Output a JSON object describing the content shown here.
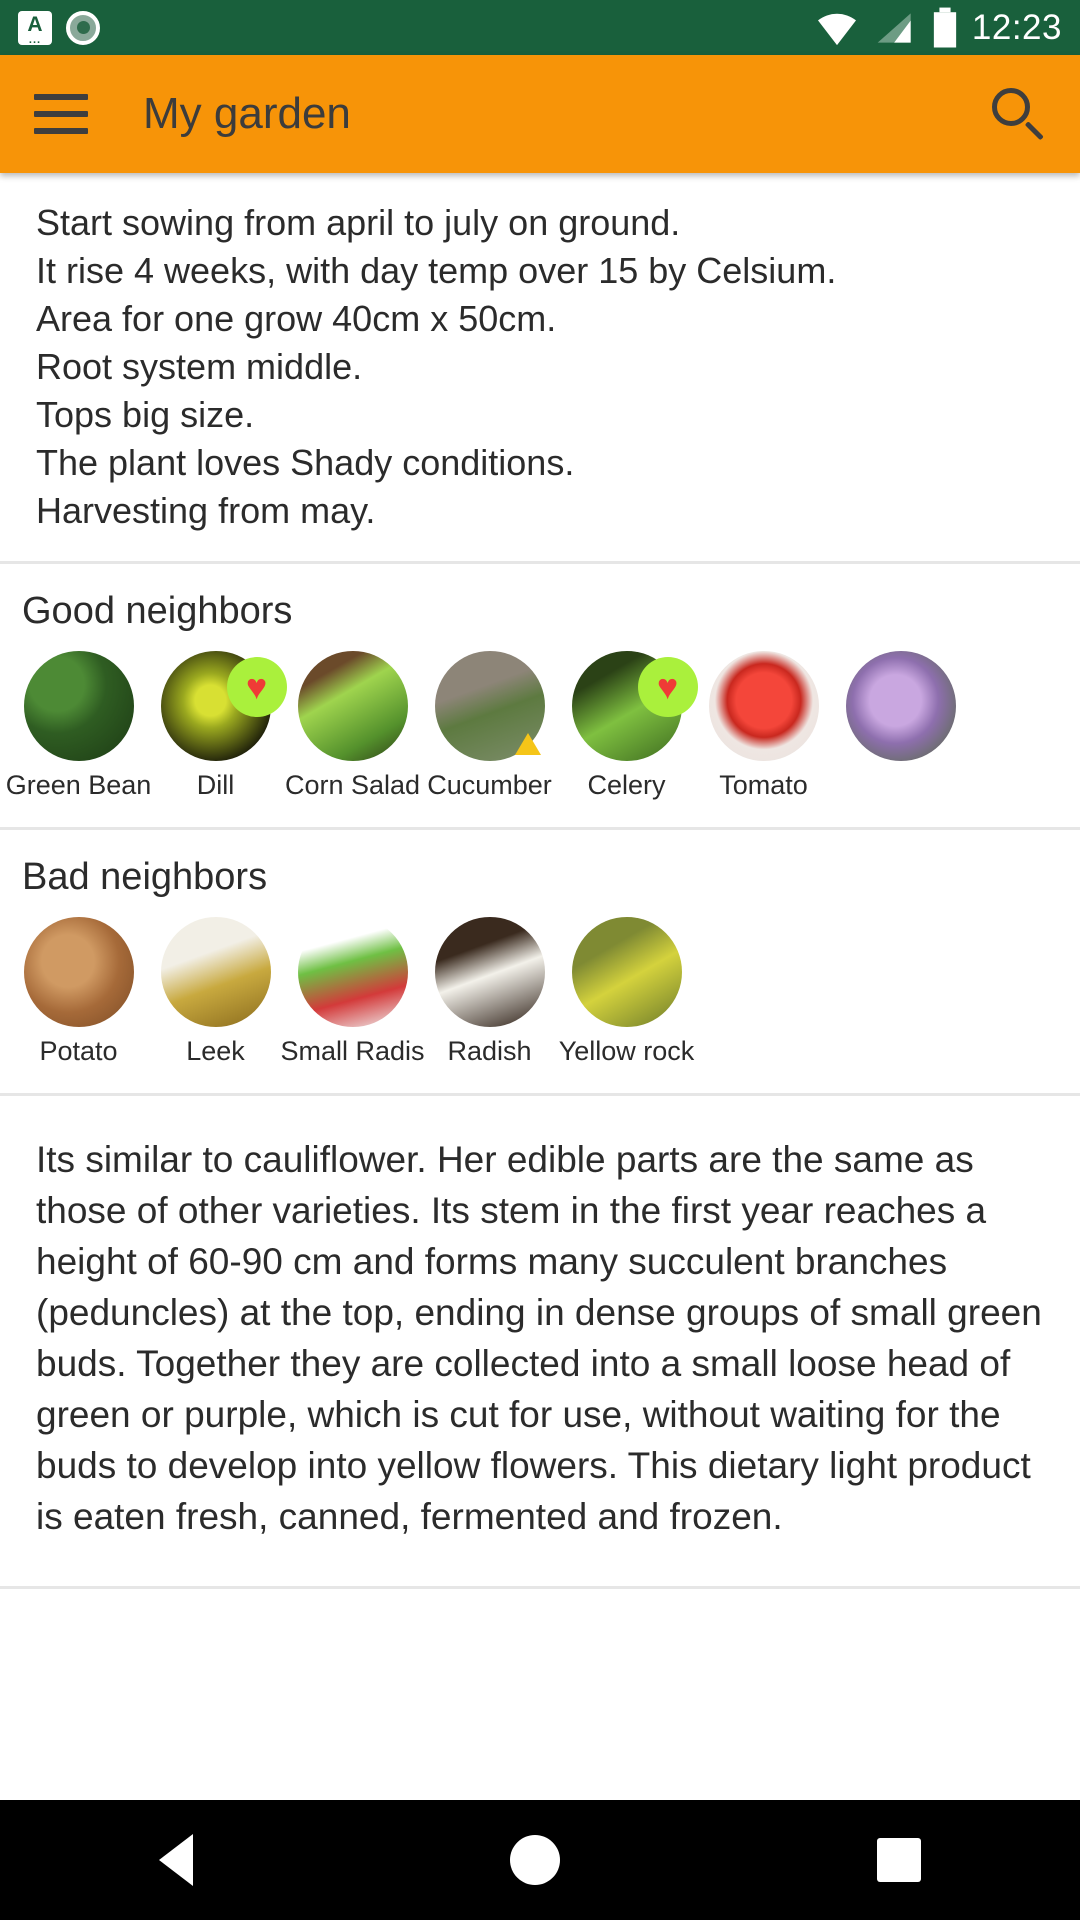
{
  "status_bar": {
    "time": "12:23",
    "icons": [
      "app-letter-a-icon",
      "record-circle-icon",
      "wifi-icon",
      "signal-icon",
      "battery-icon"
    ],
    "background_color": "#19603c",
    "letter_icon_text": "A"
  },
  "app_bar": {
    "menu_icon": "hamburger-menu-icon",
    "title": "My garden",
    "search_icon": "search-icon",
    "background_color": "#f79408",
    "text_color": "#3c3c3c"
  },
  "info": {
    "lines": [
      "Start sowing from april to july on ground.",
      "It rise 4 weeks, with day temp over 15 by Celsium.",
      "Area for one grow 40cm x 50cm.",
      "Root system middle.",
      "Tops big size.",
      "The plant loves Shady conditions.",
      "Harvesting from may."
    ]
  },
  "good_neighbors": {
    "title": "Good neighbors",
    "items": [
      {
        "label": "Green Bean",
        "thumb": "t-greenbean",
        "badge": "none"
      },
      {
        "label": "Dill",
        "thumb": "t-dill",
        "badge": "heart"
      },
      {
        "label": "Corn Salad",
        "thumb": "t-cornsalad",
        "badge": "none"
      },
      {
        "label": "Cucumber",
        "thumb": "t-cucumber",
        "badge": "warning"
      },
      {
        "label": "Celery",
        "thumb": "t-celery",
        "badge": "heart"
      },
      {
        "label": "Tomato",
        "thumb": "t-tomato",
        "badge": "none"
      },
      {
        "label": "",
        "thumb": "t-flower",
        "badge": "none"
      }
    ]
  },
  "bad_neighbors": {
    "title": "Bad neighbors",
    "items": [
      {
        "label": "Potato",
        "thumb": "t-potato",
        "badge": "none"
      },
      {
        "label": "Leek",
        "thumb": "t-leek",
        "badge": "none"
      },
      {
        "label": "Small Radis",
        "thumb": "t-smallradis",
        "badge": "none"
      },
      {
        "label": "Radish",
        "thumb": "t-radish",
        "badge": "none"
      },
      {
        "label": "Yellow rock",
        "thumb": "t-yellowrock",
        "badge": "none"
      }
    ]
  },
  "description": {
    "text": "Its similar to cauliflower. Her edible parts are the same as those of other varieties. Its stem in the first year reaches a height of 60-90 cm and forms many succulent branches (peduncles) at the top, ending in dense groups of small green buds. Together they are collected into a small loose head of green or purple, which is cut for use, without waiting for the buds to develop into yellow flowers. This dietary light product is eaten fresh, canned, fermented and frozen."
  },
  "nav_bar": {
    "back": "back-triangle-icon",
    "home": "home-circle-icon",
    "recents": "recents-square-icon",
    "background_color": "#000000"
  },
  "accent_colors": {
    "heart_badge_bg": "#aaf03c",
    "heart": "#ef3b36",
    "warning": "#f5c518"
  }
}
